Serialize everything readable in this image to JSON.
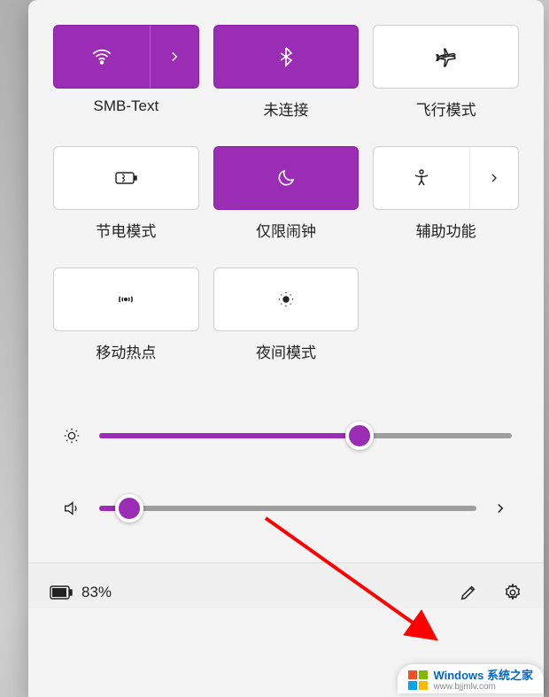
{
  "tiles": [
    {
      "id": "wifi",
      "label": "SMB-Text",
      "active": true,
      "expandable": true,
      "icon": "wifi-icon"
    },
    {
      "id": "bluetooth",
      "label": "未连接",
      "active": true,
      "expandable": false,
      "icon": "bluetooth-icon"
    },
    {
      "id": "airplane",
      "label": "飞行模式",
      "active": false,
      "expandable": false,
      "icon": "airplane-icon"
    },
    {
      "id": "battery-saver",
      "label": "节电模式",
      "active": false,
      "expandable": false,
      "icon": "battery-saver-icon"
    },
    {
      "id": "focus",
      "label": "仅限闹钟",
      "active": true,
      "expandable": false,
      "icon": "moon-icon"
    },
    {
      "id": "accessibility",
      "label": "辅助功能",
      "active": false,
      "expandable": true,
      "icon": "accessibility-icon"
    },
    {
      "id": "hotspot",
      "label": "移动热点",
      "active": false,
      "expandable": false,
      "icon": "hotspot-icon"
    },
    {
      "id": "night-light",
      "label": "夜间模式",
      "active": false,
      "expandable": false,
      "icon": "night-light-icon"
    }
  ],
  "sliders": {
    "brightness": {
      "value": 63
    },
    "volume": {
      "value": 8,
      "expandable": true
    }
  },
  "footer": {
    "battery_percent": "83%"
  },
  "colors": {
    "accent": "#9a2db3"
  },
  "watermark": {
    "line1": "Windows 系统之家",
    "line2": "www.bjjmlv.com"
  }
}
